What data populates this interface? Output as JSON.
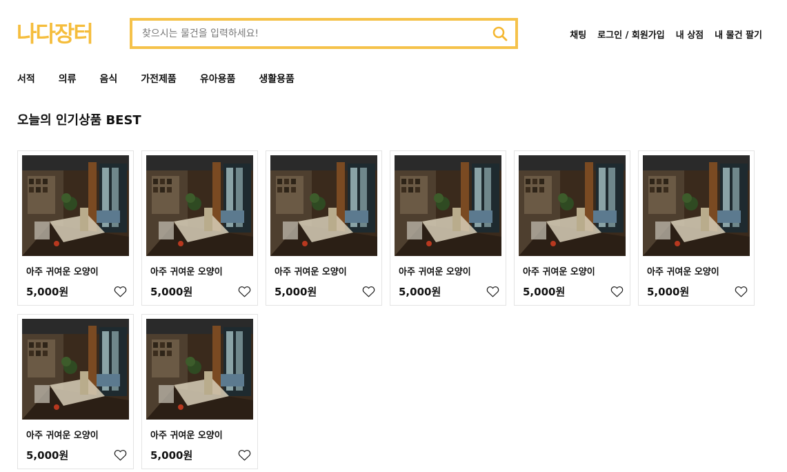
{
  "header": {
    "logo": "나다장터",
    "search": {
      "placeholder": "찾으시는 물건을 입력하세요!",
      "value": ""
    },
    "nav": [
      "채팅",
      "로그인 / 회원가입",
      "내 상점",
      "내 물건 팔기"
    ]
  },
  "categories": [
    "서적",
    "의류",
    "음식",
    "가전제품",
    "유아용품",
    "생활용품"
  ],
  "section": {
    "title": "오늘의 인기상품 BEST"
  },
  "products": [
    {
      "title": "아주 귀여운 오양이",
      "price": "5,000원"
    },
    {
      "title": "아주 귀여운 오양이",
      "price": "5,000원"
    },
    {
      "title": "아주 귀여운 오양이",
      "price": "5,000원"
    },
    {
      "title": "아주 귀여운 오양이",
      "price": "5,000원"
    },
    {
      "title": "아주 귀여운 오양이",
      "price": "5,000원"
    },
    {
      "title": "아주 귀여운 오양이",
      "price": "5,000원"
    },
    {
      "title": "아주 귀여운 오양이",
      "price": "5,000원"
    },
    {
      "title": "아주 귀여운 오양이",
      "price": "5,000원"
    }
  ],
  "icons": {
    "search": "search-icon",
    "heart": "heart-outline-icon"
  },
  "colors": {
    "accent": "#F5BD3C"
  }
}
